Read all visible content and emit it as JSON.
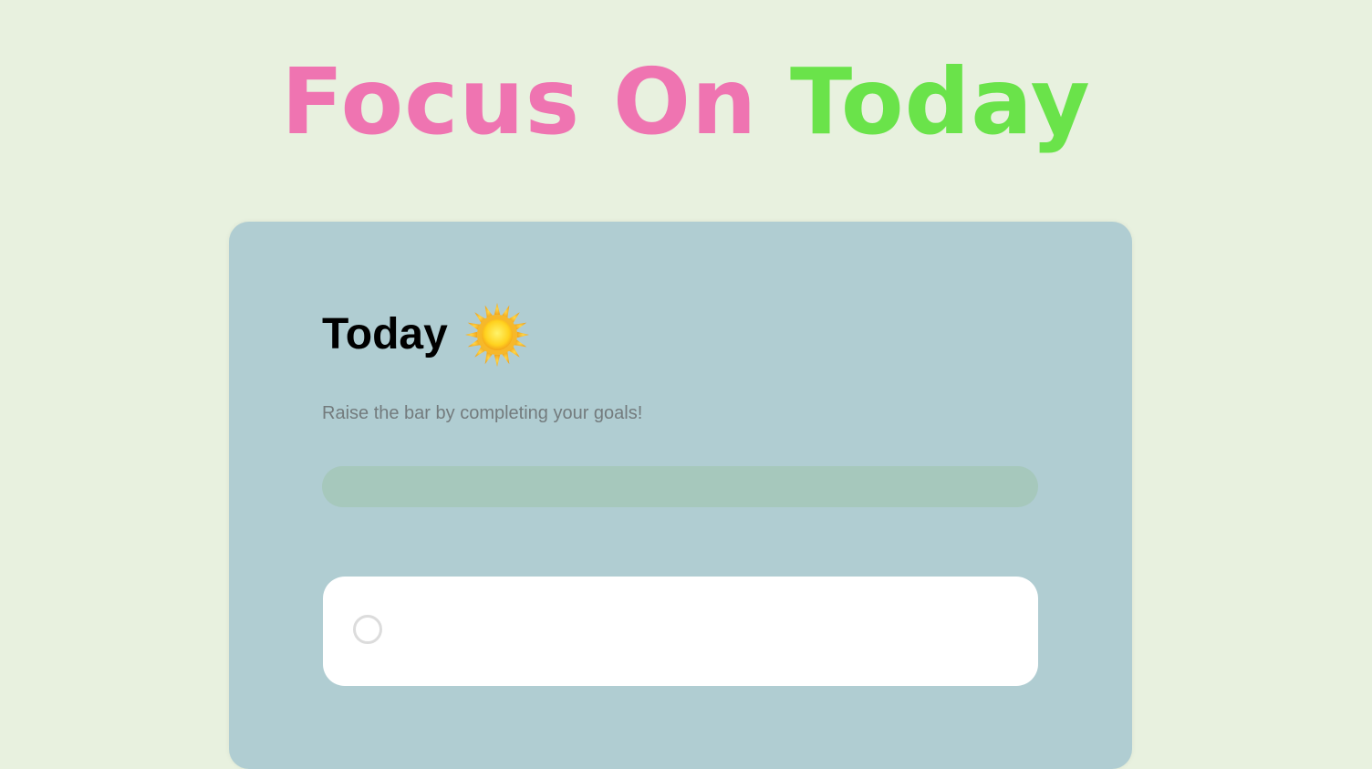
{
  "header": {
    "title_part1": "Focus On",
    "title_part2": "Today",
    "colors": {
      "part1": "#ef74b1",
      "part2": "#6ae34a",
      "background": "#e8f1df"
    }
  },
  "card": {
    "heading": "Today",
    "heading_icon": "sun-icon",
    "subtitle": "Raise the bar by completing your goals!",
    "background": "#b0cdd2",
    "progress": {
      "value": 0,
      "track_color": "#a6c8bc"
    },
    "goals": [
      {
        "completed": false,
        "text": "",
        "placeholder": ""
      }
    ]
  }
}
